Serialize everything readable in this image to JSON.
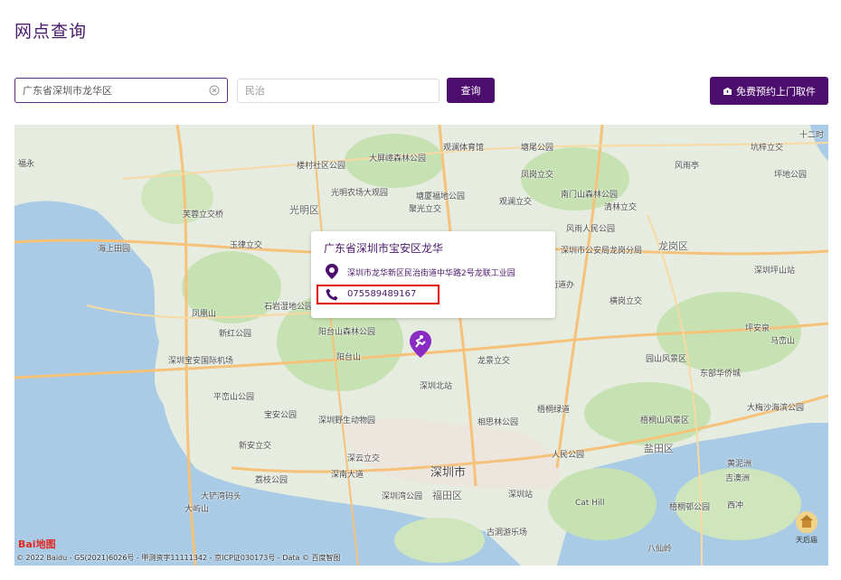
{
  "page": {
    "title": "网点查询"
  },
  "search": {
    "value": "广东省深圳市龙华区",
    "district_placeholder": "民治",
    "query_label": "查询",
    "pickup_label": "免费预约上门取件"
  },
  "map": {
    "labels": [
      "福永",
      "楼村社区公园",
      "大屏嶂森林公园",
      "坑梓立交",
      "十二时",
      "观澜体育馆",
      "塘尾公园",
      "凤岗立交",
      "风雨亭",
      "坪地公园",
      "光明农场大观园",
      "光明区",
      "塘厦福地公园",
      "南门山森林公园",
      "清林立交",
      "芙蓉立交桥",
      "聚光立交",
      "观澜立交",
      "风雨人民公园",
      "龙岗区",
      "海上田园",
      "玉律立交",
      "深圳坪山站",
      "石岩湿地公园",
      "凤凰山",
      "深圳市公安局龙岗分局",
      "横岗立交",
      "水库街道办",
      "坪安泉",
      "马峦山",
      "新红公园",
      "阳台山森林公园",
      "龙景立交",
      "园山风景区",
      "东部华侨城",
      "深圳宝安国际机场",
      "阳台山",
      "深圳北站",
      "大梅沙海滨公园",
      "平峦山公园",
      "宝安公园",
      "深圳野生动物园",
      "相思林公园",
      "梧桐绿道",
      "梧桐山风景区",
      "盐田区",
      "新安立交",
      "深云立交",
      "人民公园",
      "黄泥洲",
      "深南大道",
      "深圳市",
      "吉澳洲",
      "荔枝公园",
      "大铲湾码头",
      "深圳湾公园",
      "福田区",
      "深圳站",
      "Cat Hill",
      "梧桐邨公园",
      "西冲",
      "大屿山",
      "古洞游乐场",
      "八仙岭",
      "天后庙"
    ],
    "baidu_logo": "Bai地图",
    "copyright": "© 2022 Baidu - GS(2021)6026号 - 甲测资字11111342 - 京ICP证030173号 - Data © 百度智图",
    "tool_label": "天后庙"
  },
  "popup": {
    "title": "广东省深圳市宝安区龙华",
    "address": "深圳市龙华新区民治街道中华路2号龙联工业园",
    "phone": "075589489167"
  },
  "colors": {
    "brand": "#4d0f6e",
    "highlight": "#e00000"
  }
}
